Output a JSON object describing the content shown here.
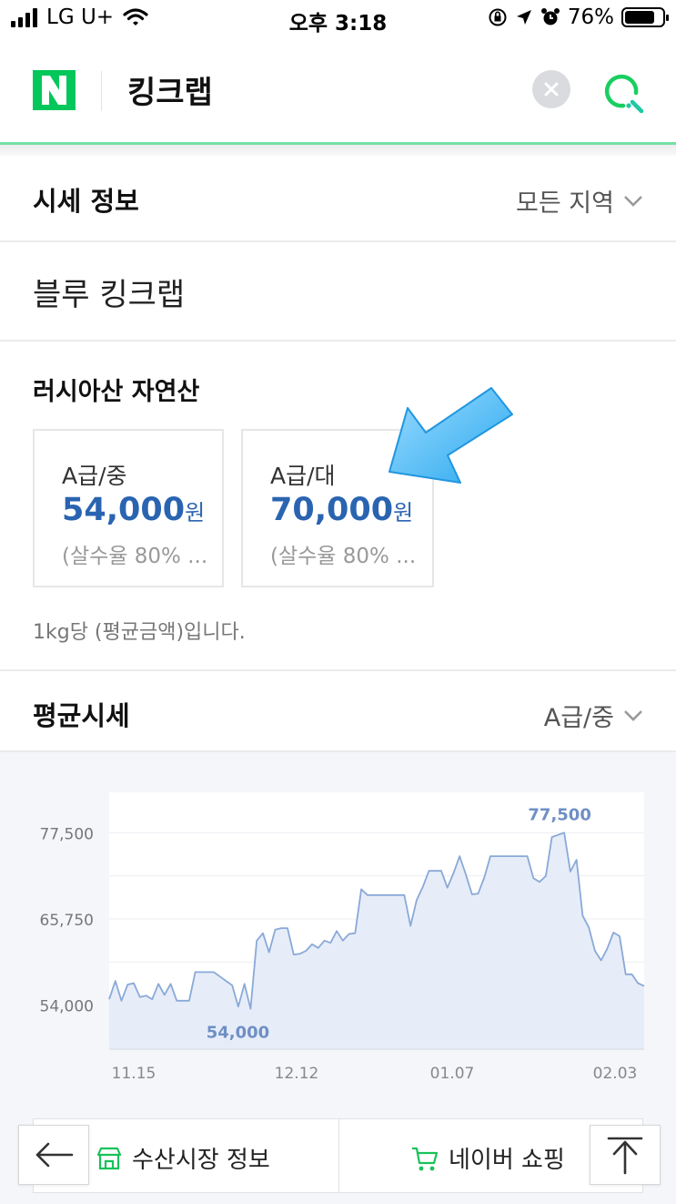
{
  "status_bar": {
    "carrier": "LG U+",
    "time": "오후 3:18",
    "battery": "76%",
    "signal_icon": "signal-bars-icon",
    "wifi_icon": "wifi-icon"
  },
  "header": {
    "logo": "N",
    "title": "킹크랩",
    "brand_color": "#03c75a"
  },
  "price_info": {
    "title": "시세 정보",
    "region_select": "모든 지역"
  },
  "product": {
    "name": "블루 킹크랩"
  },
  "origin": {
    "title": "러시아산 자연산",
    "cards": [
      {
        "grade": "A급/중",
        "price": "54,000",
        "unit": "원",
        "note": "(살수율 80% ..."
      },
      {
        "grade": "A급/대",
        "price": "70,000",
        "unit": "원",
        "note": "(살수율 80% ..."
      }
    ],
    "footnote": "1kg당 (평균금액)입니다.",
    "price_color": "#2a64b1"
  },
  "average": {
    "title": "평균시세",
    "grade_select": "A급/중"
  },
  "chart_data": {
    "type": "area",
    "ytick_labels": [
      "77,500",
      "65,750",
      "54,000"
    ],
    "yticks": [
      77500,
      65750,
      54000
    ],
    "xtick_labels": [
      "11.15",
      "12.12",
      "01.07",
      "02.03"
    ],
    "ylim": [
      48000,
      83000
    ],
    "max_label": "77,500",
    "min_label": "54,000",
    "line_color": "#8aa9d8",
    "fill_color": "#e6edf8",
    "values": [
      54800,
      57300,
      54600,
      56800,
      57000,
      55100,
      55300,
      54800,
      56900,
      55400,
      56900,
      54600,
      54600,
      54600,
      58500,
      58500,
      58500,
      58500,
      57900,
      57300,
      56700,
      53800,
      56900,
      53500,
      62800,
      63800,
      61200,
      64300,
      64500,
      64500,
      60900,
      61000,
      61400,
      62300,
      61800,
      62800,
      62500,
      64100,
      62800,
      63700,
      63800,
      69800,
      69000,
      69000,
      69000,
      69000,
      69000,
      69000,
      69000,
      64800,
      68300,
      70100,
      72300,
      72300,
      72300,
      70000,
      72000,
      74300,
      71800,
      69100,
      69200,
      71400,
      74300,
      74300,
      74300,
      74300,
      74300,
      74300,
      74300,
      71300,
      70800,
      71600,
      76900,
      77200,
      77500,
      72200,
      73800,
      66200,
      64600,
      61400,
      60100,
      61700,
      63900,
      63400,
      58200,
      58200,
      57000,
      56600
    ]
  },
  "bottom_bar": {
    "market_info": "수산시장 정보",
    "naver_shopping": "네이버 쇼핑",
    "back_icon": "arrow-left-icon",
    "top_icon": "arrow-up-icon"
  }
}
